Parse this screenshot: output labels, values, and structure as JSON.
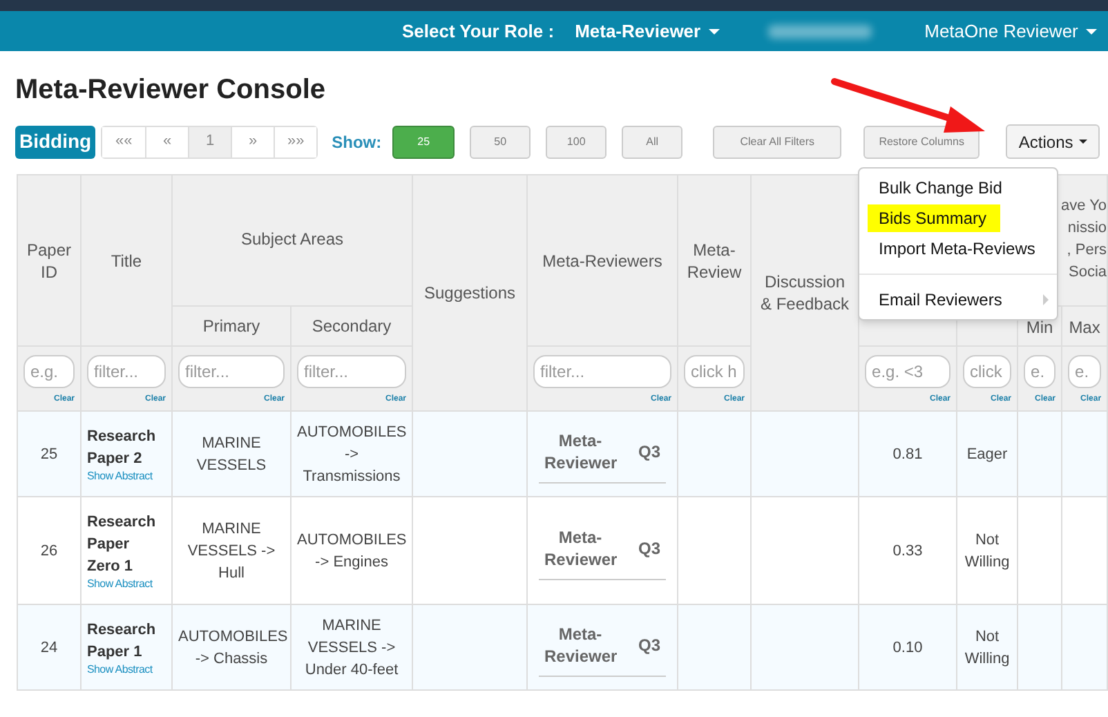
{
  "navbar": {
    "role_label": "Select Your Role :",
    "role": "Meta-Reviewer",
    "user": "MetaOne Reviewer"
  },
  "page_title": "Meta-Reviewer Console",
  "toolbar": {
    "badge": "Bidding",
    "pagination": [
      {
        "label": "««",
        "selected": false
      },
      {
        "label": "«",
        "selected": false
      },
      {
        "label": "1",
        "selected": true
      },
      {
        "label": "»",
        "selected": false
      },
      {
        "label": "»»",
        "selected": false
      }
    ],
    "show_label": "Show:",
    "page_sizes": [
      {
        "label": "25",
        "selected": true
      },
      {
        "label": "50",
        "selected": false
      },
      {
        "label": "100",
        "selected": false
      },
      {
        "label": "All",
        "selected": false
      }
    ],
    "buttons": [
      "Clear All Filters",
      "Restore Columns"
    ],
    "actions": "Actions"
  },
  "actions_menu": [
    {
      "label": "Bulk Change Bid",
      "highlighted": false,
      "submenu": false,
      "divider_before": false
    },
    {
      "label": "Bids Summary",
      "highlighted": true,
      "submenu": false,
      "divider_before": false
    },
    {
      "label": "Import Meta-Reviews",
      "highlighted": false,
      "submenu": false,
      "divider_before": false
    },
    {
      "label": "Email Reviewers",
      "highlighted": false,
      "submenu": true,
      "divider_before": true
    }
  ],
  "table": {
    "headers": {
      "paper_id": "Paper ID",
      "title": "Title",
      "subject_areas": "Subject Areas",
      "primary": "Primary",
      "secondary": "Secondary",
      "suggestions": "Suggestions",
      "meta_reviewers": "Meta-Reviewers",
      "meta_review": "Meta-Review",
      "discussion": "Discussion & Feedback",
      "column_11_group": [
        "ave Yo",
        "nissio",
        ", Pers",
        "Socia"
      ],
      "min": "Min",
      "max": "Max"
    },
    "filters": [
      {
        "placeholder": "e.g.",
        "clear": "Clear"
      },
      {
        "placeholder": "filter...",
        "clear": "Clear"
      },
      {
        "placeholder": "filter...",
        "clear": "Clear"
      },
      {
        "placeholder": "filter...",
        "clear": "Clear"
      },
      {
        "placeholder": "filter...",
        "clear": "Clear"
      },
      {
        "placeholder": "click h",
        "clear": "Clear"
      },
      {
        "placeholder": "e.g. <3",
        "clear": "Clear"
      },
      {
        "placeholder": "click",
        "clear": "Clear"
      },
      {
        "placeholder": "e.",
        "clear": "Clear"
      },
      {
        "placeholder": "e.",
        "clear": "Clear"
      }
    ],
    "rows": [
      {
        "paper_id": "25",
        "title": "Research Paper 2",
        "abstract_link": "Show Abstract",
        "primary": "MARINE VESSELS",
        "secondary": "AUTOMOBILES -> Transmissions",
        "meta_reviewer": "Meta-Reviewer",
        "quartile": "Q3",
        "column_9": "0.81",
        "column_10": "Eager"
      },
      {
        "paper_id": "26",
        "title": "Research Paper Zero 1",
        "abstract_link": "Show Abstract",
        "primary": "MARINE VESSELS -> Hull",
        "secondary": "AUTOMOBILES -> Engines",
        "meta_reviewer": "Meta-Reviewer",
        "quartile": "Q3",
        "column_9": "0.33",
        "column_10": "Not Willing"
      },
      {
        "paper_id": "24",
        "title": "Research Paper 1",
        "abstract_link": "Show Abstract",
        "primary": "AUTOMOBILES -> Chassis",
        "secondary": "MARINE VESSELS -> Under 40-feet",
        "meta_reviewer": "Meta-Reviewer",
        "quartile": "Q3",
        "column_9": "0.10",
        "column_10": "Not Willing"
      }
    ]
  }
}
